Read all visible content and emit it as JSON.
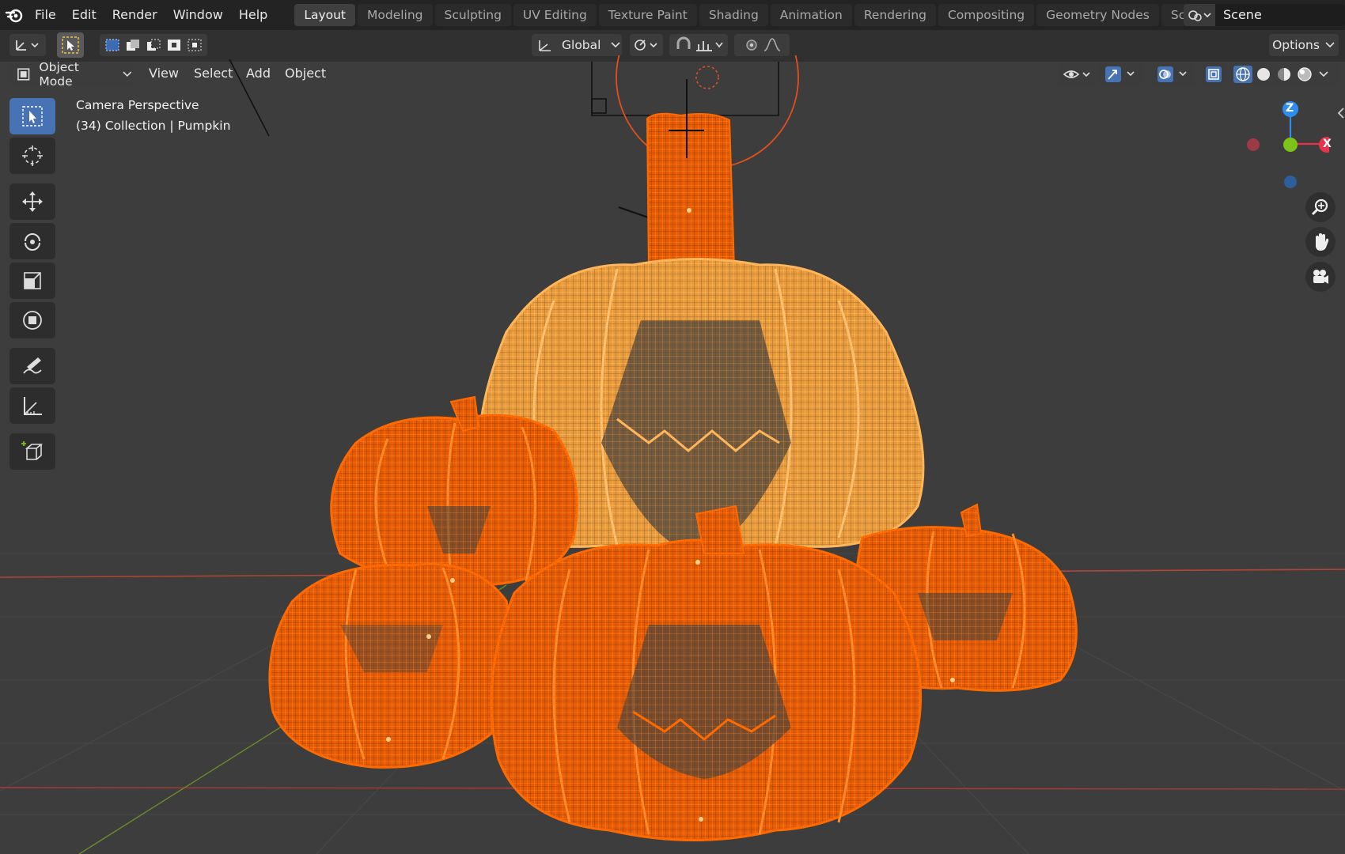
{
  "menu": {
    "items": [
      "File",
      "Edit",
      "Render",
      "Window",
      "Help"
    ]
  },
  "workspaces": {
    "tabs": [
      "Layout",
      "Modeling",
      "Sculpting",
      "UV Editing",
      "Texture Paint",
      "Shading",
      "Animation",
      "Rendering",
      "Compositing",
      "Geometry Nodes",
      "Scripting"
    ],
    "active": "Layout"
  },
  "scene": {
    "name": "Scene"
  },
  "tool_header": {
    "orientation": "Global",
    "options_label": "Options"
  },
  "viewport_header": {
    "mode": "Object Mode",
    "menus": [
      "View",
      "Select",
      "Add",
      "Object"
    ]
  },
  "viewport": {
    "perspective_label": "Camera Perspective",
    "collection_label": "(34) Collection | Pumpkin"
  },
  "gizmo": {
    "z_label": "Z",
    "x_label": "X"
  },
  "colors": {
    "accent": "#4772b3",
    "wire_orange": "#ff6a00",
    "wire_light": "#ffa040",
    "axis_x": "#e8334a",
    "axis_y": "#7dc31a",
    "axis_z": "#2d8cf0"
  }
}
